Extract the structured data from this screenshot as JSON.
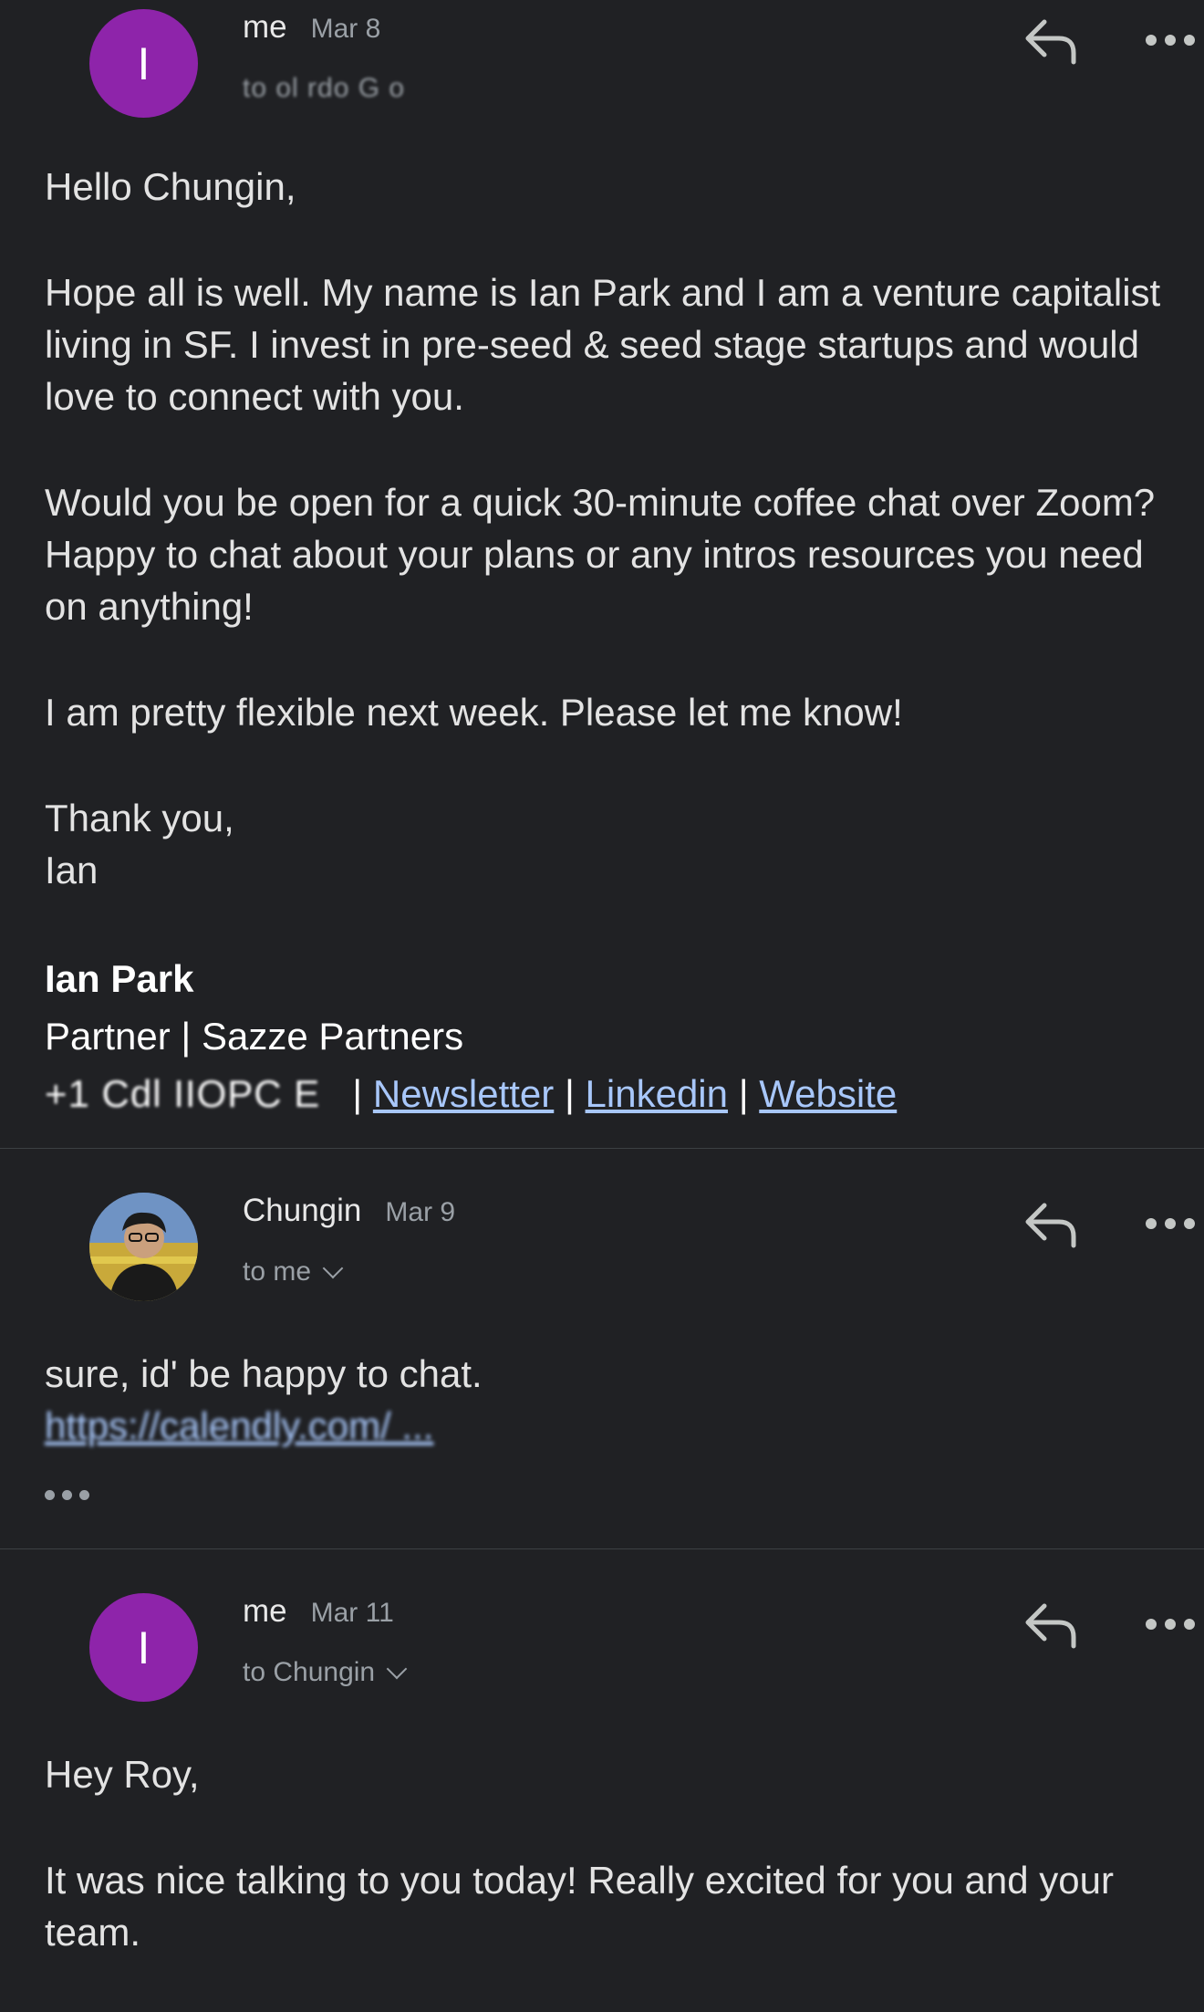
{
  "messages": [
    {
      "sender": "me",
      "date": "Mar 8",
      "to": "to ol rdo G o",
      "avatar_letter": "I",
      "avatar_color": "#8e24aa",
      "greeting": "Hello Chungin,",
      "paragraphs": [
        "Hope all is well. My name is Ian Park and I am a venture capitalist living in SF. I invest in pre-seed & seed stage startups and would love to connect with you.",
        "Would you be open for a quick 30-minute coffee chat over Zoom? Happy to chat about your plans or any intros resources you need on anything!",
        "I am pretty flexible next week. Please let me know!"
      ],
      "closing": "Thank you,",
      "closing_name": "Ian",
      "signature": {
        "name": "Ian Park",
        "title": "Partner | Sazze Partners",
        "phone": "+1 Cdl IIOPC E",
        "links": [
          "Newsletter",
          "Linkedin",
          "Website"
        ]
      }
    },
    {
      "sender": "Chungin",
      "date": "Mar 9",
      "to": "to me",
      "body": "sure, id' be happy to chat.",
      "link": "https://calendly.com/ ...",
      "avatar_icon": "profile-photo"
    },
    {
      "sender": "me",
      "date": "Mar 11",
      "to": "to Chungin",
      "avatar_letter": "I",
      "avatar_color": "#8e24aa",
      "greeting": "Hey Roy,",
      "paragraph": "It was nice talking to you today! Really excited for you and your team."
    }
  ],
  "icons": {
    "reply": "reply-icon",
    "more": "more-options-icon"
  }
}
